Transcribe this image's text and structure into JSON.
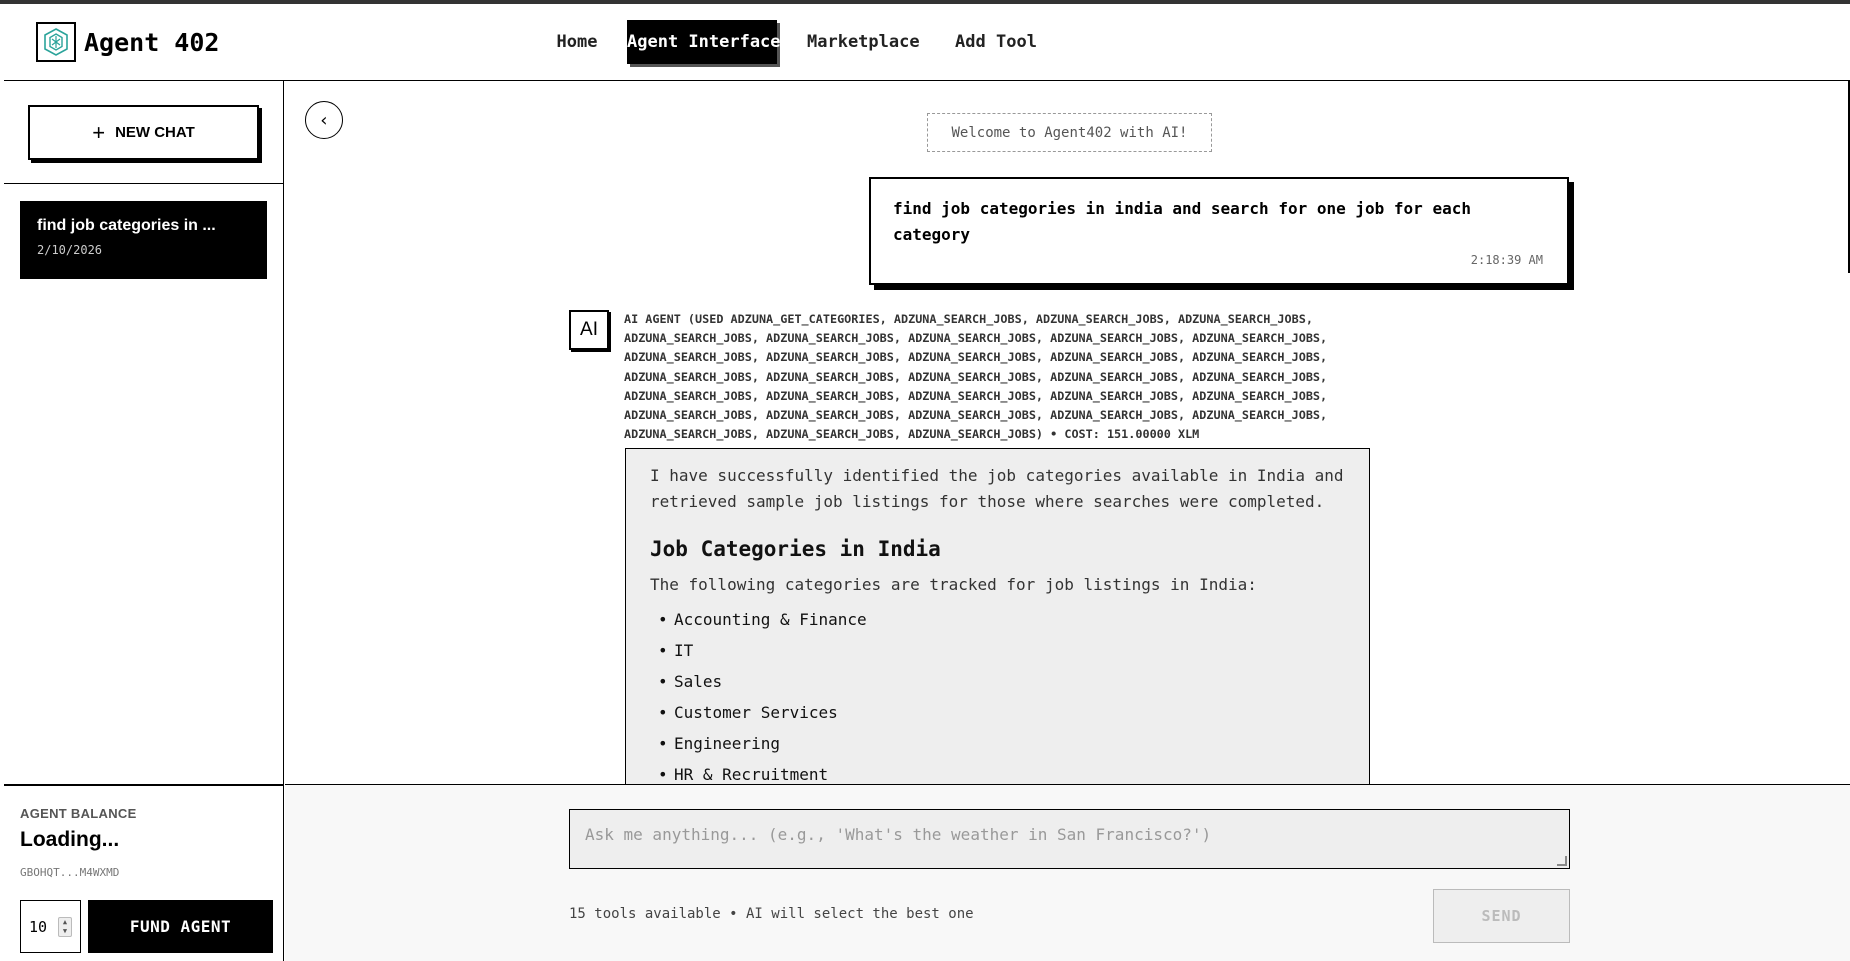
{
  "app": {
    "title": "Agent 402",
    "logo_icon": "agent-logo-icon"
  },
  "nav": {
    "items": [
      {
        "label": "Home",
        "active": false
      },
      {
        "label": "Agent Interface",
        "active": true
      },
      {
        "label": "Marketplace",
        "active": false
      },
      {
        "label": "Add Tool",
        "active": false
      }
    ]
  },
  "sidebar": {
    "new_chat_label": "NEW CHAT",
    "chats": [
      {
        "title": "find job categories in ...",
        "date": "2/10/2026"
      }
    ]
  },
  "balance": {
    "label": "AGENT BALANCE",
    "value": "Loading...",
    "address": "GBOHQT...M4WXMD",
    "amount": "10",
    "fund_label": "FUND AGENT"
  },
  "chat": {
    "welcome": "Welcome to Agent402 with AI!",
    "user_message": {
      "text": "find job categories in india and search for one job for each category",
      "time": "2:18:39 AM"
    },
    "ai": {
      "avatar_label": "AI",
      "meta": "AI AGENT (USED ADZUNA_GET_CATEGORIES, ADZUNA_SEARCH_JOBS, ADZUNA_SEARCH_JOBS, ADZUNA_SEARCH_JOBS, ADZUNA_SEARCH_JOBS, ADZUNA_SEARCH_JOBS, ADZUNA_SEARCH_JOBS, ADZUNA_SEARCH_JOBS, ADZUNA_SEARCH_JOBS, ADZUNA_SEARCH_JOBS, ADZUNA_SEARCH_JOBS, ADZUNA_SEARCH_JOBS, ADZUNA_SEARCH_JOBS, ADZUNA_SEARCH_JOBS, ADZUNA_SEARCH_JOBS, ADZUNA_SEARCH_JOBS, ADZUNA_SEARCH_JOBS, ADZUNA_SEARCH_JOBS, ADZUNA_SEARCH_JOBS, ADZUNA_SEARCH_JOBS, ADZUNA_SEARCH_JOBS, ADZUNA_SEARCH_JOBS, ADZUNA_SEARCH_JOBS, ADZUNA_SEARCH_JOBS, ADZUNA_SEARCH_JOBS, ADZUNA_SEARCH_JOBS, ADZUNA_SEARCH_JOBS, ADZUNA_SEARCH_JOBS, ADZUNA_SEARCH_JOBS, ADZUNA_SEARCH_JOBS, ADZUNA_SEARCH_JOBS, ADZUNA_SEARCH_JOBS) • COST: 151.00000 XLM",
      "intro": "I have successfully identified the job categories available in India and retrieved sample job listings for those where searches were completed.",
      "heading": "Job Categories in India",
      "subtext": "The following categories are tracked for job listings in India:",
      "categories": [
        "Accounting & Finance",
        "IT",
        "Sales",
        "Customer Services",
        "Engineering",
        "HR & Recruitment"
      ]
    }
  },
  "composer": {
    "placeholder": "Ask me anything... (e.g., 'What's the weather in San Francisco?')",
    "tools_info": "15 tools available • AI will select the best one",
    "send_label": "SEND"
  }
}
